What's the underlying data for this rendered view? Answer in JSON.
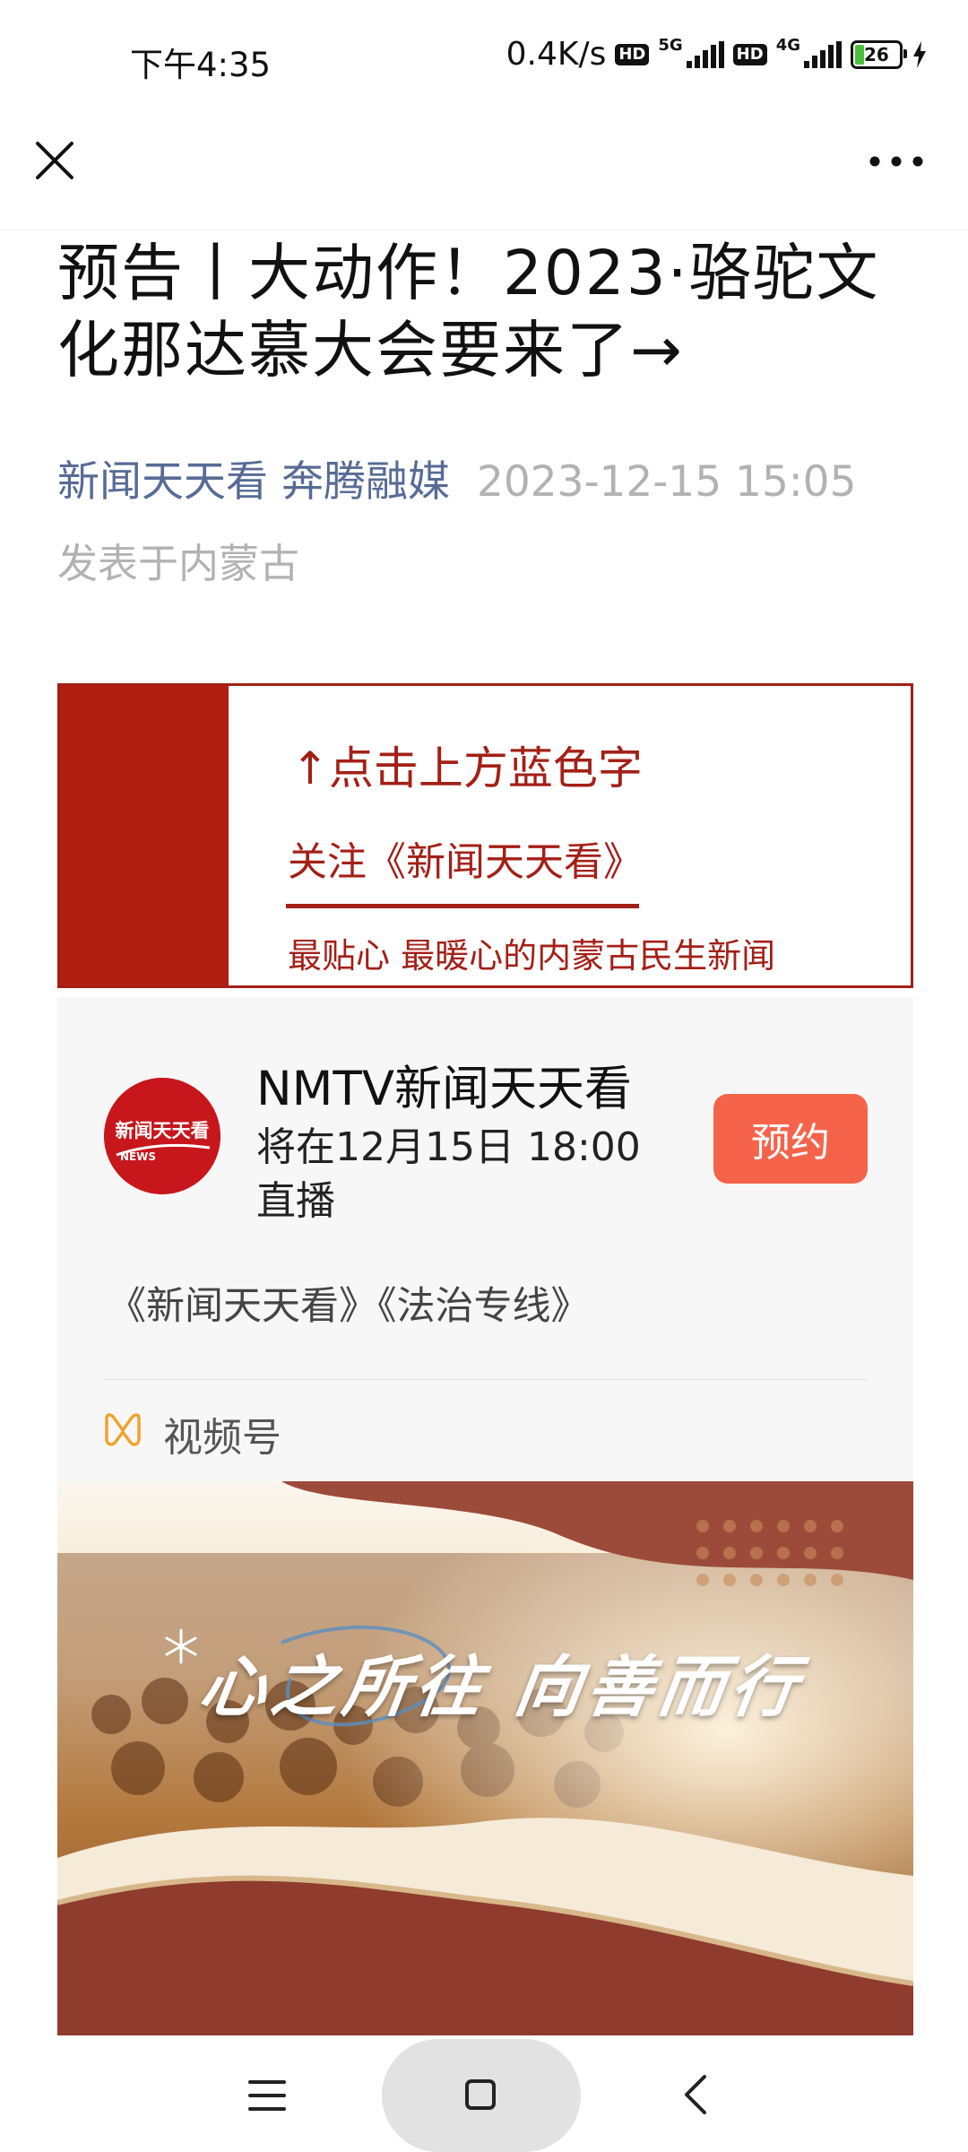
{
  "status_bar": {
    "time": "下午4:35",
    "net_speed": "0.4K/s",
    "hd": "HD",
    "net_5g": "5G",
    "net_4g": "4G",
    "battery": "26"
  },
  "nav": {
    "close_icon": "close-icon",
    "more_icon": "more-icon"
  },
  "article": {
    "title": "预告丨大动作！2023·骆驼文化那达慕大会要来了→",
    "author": "新闻天天看 奔腾融媒",
    "date": "2023-12-15 15:05",
    "location": "发表于内蒙古"
  },
  "banner": {
    "line1": "↑点击上方蓝色字",
    "line2": "关注《新闻天天看》",
    "line3": "最贴心 最暖心的内蒙古民生新闻",
    "color": "#a32017"
  },
  "channel_card": {
    "avatar_text": "新闻天天看",
    "avatar_sub": "NEWS",
    "name": "NMTV新闻天天看",
    "schedule": "将在12月15日 18:00 直播",
    "reserve_label": "预约",
    "programs": "《新闻天天看》《法治专线》",
    "platform": "视频号",
    "accent": "#f5644a"
  },
  "video_cover": {
    "slogan": "心之所往 向善而行"
  },
  "bottom_nav": {
    "menu_icon": "menu-icon",
    "home_icon": "home-icon",
    "back_icon": "back-icon"
  }
}
